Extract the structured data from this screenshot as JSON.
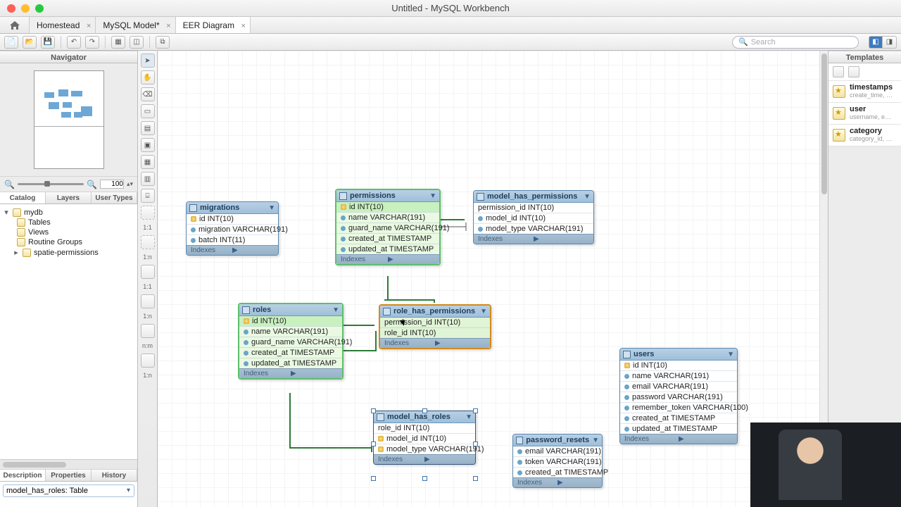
{
  "window": {
    "title": "Untitled - MySQL Workbench"
  },
  "tabs": [
    {
      "label": "Homestead",
      "active": false
    },
    {
      "label": "MySQL Model*",
      "active": false
    },
    {
      "label": "EER Diagram",
      "active": true
    }
  ],
  "search": {
    "placeholder": "Search"
  },
  "zoom": {
    "value": "100"
  },
  "left_panel": {
    "header": "Navigator",
    "category_tabs": [
      "Catalog",
      "Layers",
      "User Types"
    ],
    "tree": {
      "schemas": [
        {
          "name": "mydb",
          "expanded": true,
          "children": [
            "Tables",
            "Views",
            "Routine Groups"
          ]
        },
        {
          "name": "spatie-permissions",
          "expanded": false
        }
      ]
    },
    "bottom_tabs": [
      "Description",
      "Properties",
      "History"
    ],
    "description_value": "model_has_roles: Table"
  },
  "vtools": {
    "relation_labels": [
      "1:1",
      "1:n",
      "1:1",
      "1:n",
      "n:m",
      "1:n"
    ]
  },
  "right_panel": {
    "header": "Templates",
    "items": [
      {
        "name": "timestamps",
        "sub": "create_time, …"
      },
      {
        "name": "user",
        "sub": "username, e…"
      },
      {
        "name": "category",
        "sub": "category_id, …"
      }
    ]
  },
  "tables": {
    "migrations": {
      "title": "migrations",
      "cols": [
        {
          "k": true,
          "t": "id INT(10)"
        },
        {
          "k": false,
          "t": "migration VARCHAR(191)"
        },
        {
          "k": false,
          "t": "batch INT(11)"
        }
      ],
      "idx": "Indexes"
    },
    "permissions": {
      "title": "permissions",
      "cols": [
        {
          "k": true,
          "t": "id INT(10)"
        },
        {
          "k": false,
          "t": "name VARCHAR(191)"
        },
        {
          "k": false,
          "t": "guard_name VARCHAR(191)"
        },
        {
          "k": false,
          "t": "created_at TIMESTAMP"
        },
        {
          "k": false,
          "t": "updated_at TIMESTAMP"
        }
      ],
      "idx": "Indexes"
    },
    "model_has_permissions": {
      "title": "model_has_permissions",
      "cols": [
        {
          "k": false,
          "t": "permission_id INT(10)"
        },
        {
          "k": false,
          "t": "model_id INT(10)"
        },
        {
          "k": false,
          "t": "model_type VARCHAR(191)"
        }
      ],
      "idx": "Indexes"
    },
    "roles": {
      "title": "roles",
      "cols": [
        {
          "k": true,
          "t": "id INT(10)"
        },
        {
          "k": false,
          "t": "name VARCHAR(191)"
        },
        {
          "k": false,
          "t": "guard_name VARCHAR(191)"
        },
        {
          "k": false,
          "t": "created_at TIMESTAMP"
        },
        {
          "k": false,
          "t": "updated_at TIMESTAMP"
        }
      ],
      "idx": "Indexes"
    },
    "role_has_permissions": {
      "title": "role_has_permissions",
      "cols": [
        {
          "k": false,
          "t": "permission_id INT(10)"
        },
        {
          "k": false,
          "t": "role_id INT(10)"
        }
      ],
      "idx": "Indexes"
    },
    "model_has_roles": {
      "title": "model_has_roles",
      "cols": [
        {
          "k": false,
          "t": "role_id INT(10)"
        },
        {
          "k": true,
          "t": "model_id INT(10)"
        },
        {
          "k": true,
          "t": "model_type VARCHAR(191)"
        }
      ],
      "idx": "Indexes"
    },
    "password_resets": {
      "title": "password_resets",
      "cols": [
        {
          "k": false,
          "t": "email VARCHAR(191)"
        },
        {
          "k": false,
          "t": "token VARCHAR(191)"
        },
        {
          "k": false,
          "t": "created_at TIMESTAMP"
        }
      ],
      "idx": "Indexes"
    },
    "users": {
      "title": "users",
      "cols": [
        {
          "k": true,
          "t": "id INT(10)"
        },
        {
          "k": false,
          "t": "name VARCHAR(191)"
        },
        {
          "k": false,
          "t": "email VARCHAR(191)"
        },
        {
          "k": false,
          "t": "password VARCHAR(191)"
        },
        {
          "k": false,
          "t": "remember_token VARCHAR(100)"
        },
        {
          "k": false,
          "t": "created_at TIMESTAMP"
        },
        {
          "k": false,
          "t": "updated_at TIMESTAMP"
        }
      ],
      "idx": "Indexes"
    }
  }
}
